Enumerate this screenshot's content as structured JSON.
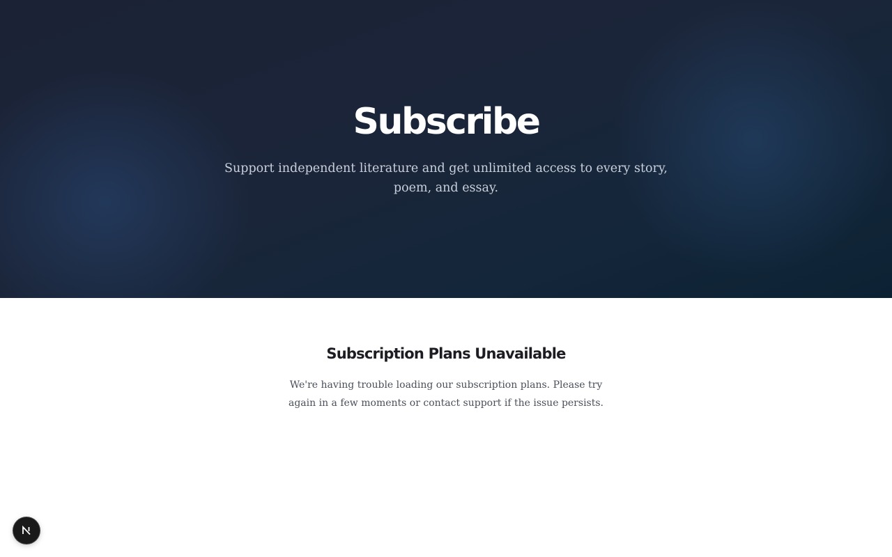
{
  "hero": {
    "title": "Subscribe",
    "subtitle": "Support independent literature and get unlimited access to every story, poem, and essay."
  },
  "notice": {
    "title": "Subscription Plans Unavailable",
    "message": "We're having trouble loading our subscription plans. Please try again in a few moments or contact support if the issue persists."
  },
  "dev_badge": {
    "icon": "nextjs-icon",
    "letter": "N"
  },
  "colors": {
    "hero_background": "#1b2539",
    "title": "#ffffff",
    "subtitle": "#c9d0dc",
    "notice_title": "#1c1c22",
    "notice_text": "#4a4f5a",
    "badge_background": "#1a1a1a"
  }
}
